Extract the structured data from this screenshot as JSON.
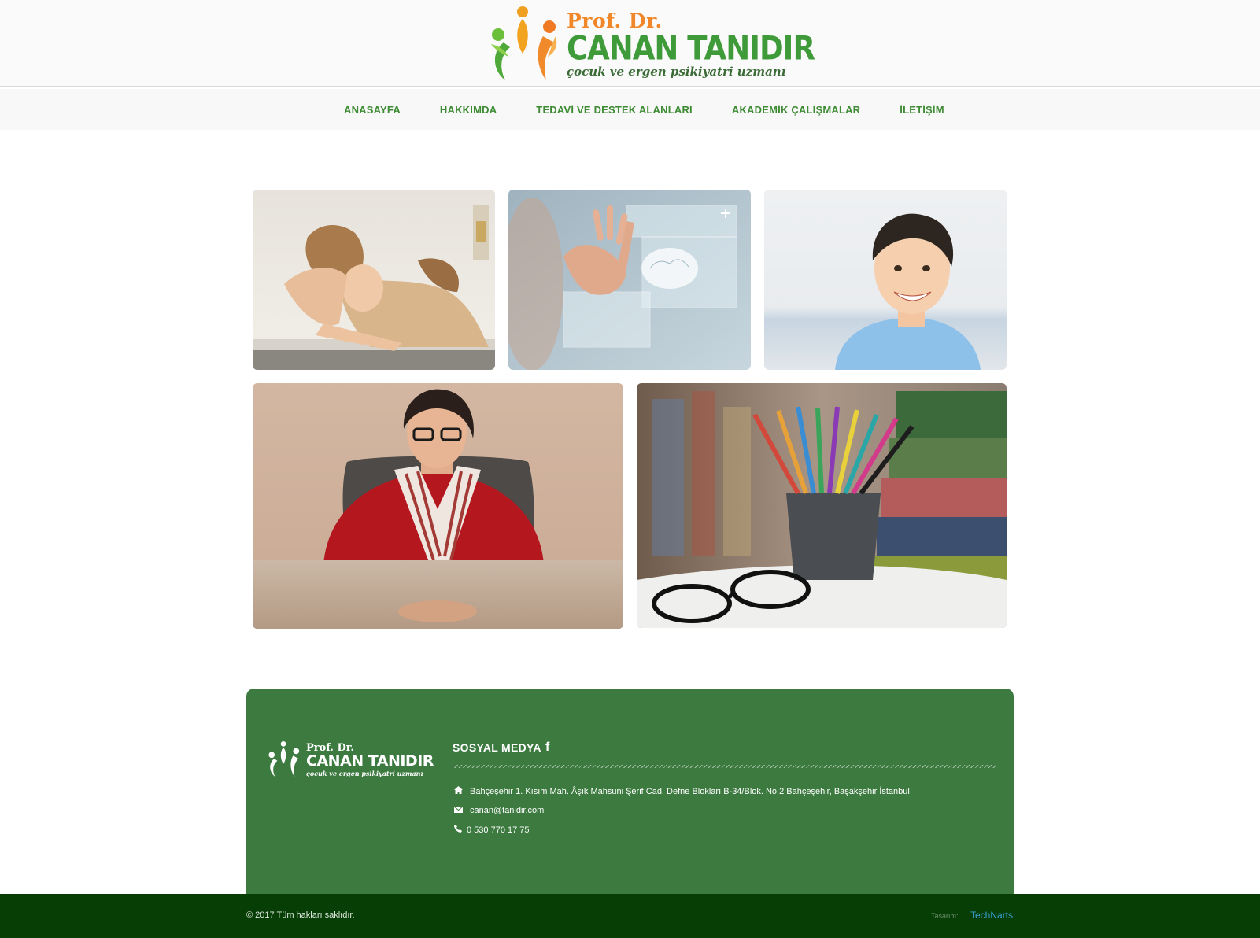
{
  "header": {
    "logo": {
      "prof": "Prof. Dr.",
      "name": "CANAN TANIDIR",
      "subtitle": "çocuk ve ergen psikiyatri uzmanı"
    }
  },
  "nav": {
    "items": [
      {
        "label": "ANASAYFA"
      },
      {
        "label": "HAKKIMDA"
      },
      {
        "label": "TEDAVİ VE DESTEK ALANLARI"
      },
      {
        "label": "AKADEMİK ÇALIŞMALAR"
      },
      {
        "label": "İLETİŞİM"
      }
    ]
  },
  "gallery": {
    "images": [
      {
        "name": "stressed-woman-photo"
      },
      {
        "name": "medical-interface-photo"
      },
      {
        "name": "smiling-boy-photo"
      },
      {
        "name": "doctor-portrait-photo"
      },
      {
        "name": "pencils-books-photo"
      }
    ]
  },
  "footer": {
    "logo": {
      "prof": "Prof. Dr.",
      "name": "CANAN TANIDIR",
      "subtitle": "çocuk ve ergen psikiyatri uzmanı"
    },
    "social_title": "SOSYAL MEDYA",
    "facebook_icon": "f",
    "contact": {
      "address_icon": "home-icon",
      "address": "Bahçeşehir 1. Kısım Mah. Âşık Mahsuni Şerif Cad. Defne Blokları B-34/Blok. No:2 Bahçeşehir, Başakşehir İstanbul",
      "email_icon": "envelope-icon",
      "email": "canan@tanidir.com",
      "phone_icon": "phone-icon",
      "phone": "0 530 770 17 75"
    },
    "copyright": "© 2017 Tüm hakları saklıdır.",
    "design_label": "Tasarım:",
    "design_link": "TechNarts"
  },
  "colors": {
    "brand_green": "#3d8b33",
    "brand_orange": "#f0882b",
    "footer_bg": "#3c7a40",
    "bottom_bar_bg": "#063e05",
    "link_blue": "#3aa0d8"
  }
}
